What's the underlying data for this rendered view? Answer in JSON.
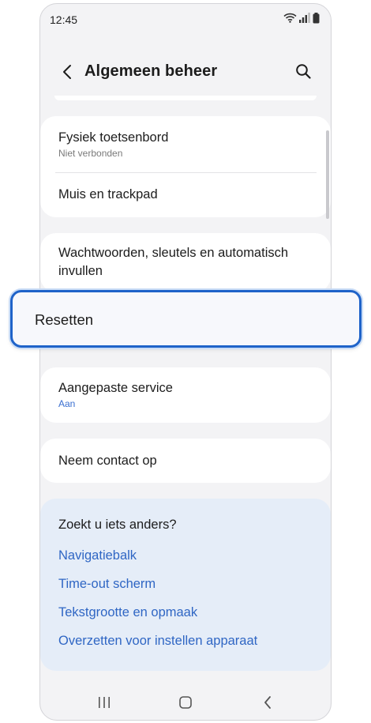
{
  "status_bar": {
    "time": "12:45"
  },
  "header": {
    "title": "Algemeen beheer"
  },
  "settings": {
    "physical_keyboard": {
      "title": "Fysiek toetsenbord",
      "subtitle": "Niet verbonden"
    },
    "mouse_trackpad": {
      "title": "Muis en trackpad"
    },
    "passwords": {
      "title": "Wachtwoorden, sleutels en automatisch invullen"
    },
    "reset": {
      "title": "Resetten"
    },
    "custom_service": {
      "title": "Aangepaste service",
      "subtitle": "Aan"
    },
    "contact": {
      "title": "Neem contact op"
    }
  },
  "related": {
    "title": "Zoekt u iets anders?",
    "links": [
      "Navigatiebalk",
      "Time-out scherm",
      "Tekstgrootte en opmaak",
      "Overzetten voor instellen apparaat"
    ]
  },
  "icons": {
    "back": "chevron-left-icon",
    "search": "search-icon",
    "wifi": "wifi-icon",
    "signal": "signal-icon",
    "battery": "battery-icon",
    "nav_recents": "recents-icon",
    "nav_home": "home-icon",
    "nav_back": "back-icon"
  },
  "colors": {
    "accent": "#1f63c9",
    "link": "#2f66c4",
    "background": "#f3f3f5",
    "related_bg": "#e5edf8"
  }
}
